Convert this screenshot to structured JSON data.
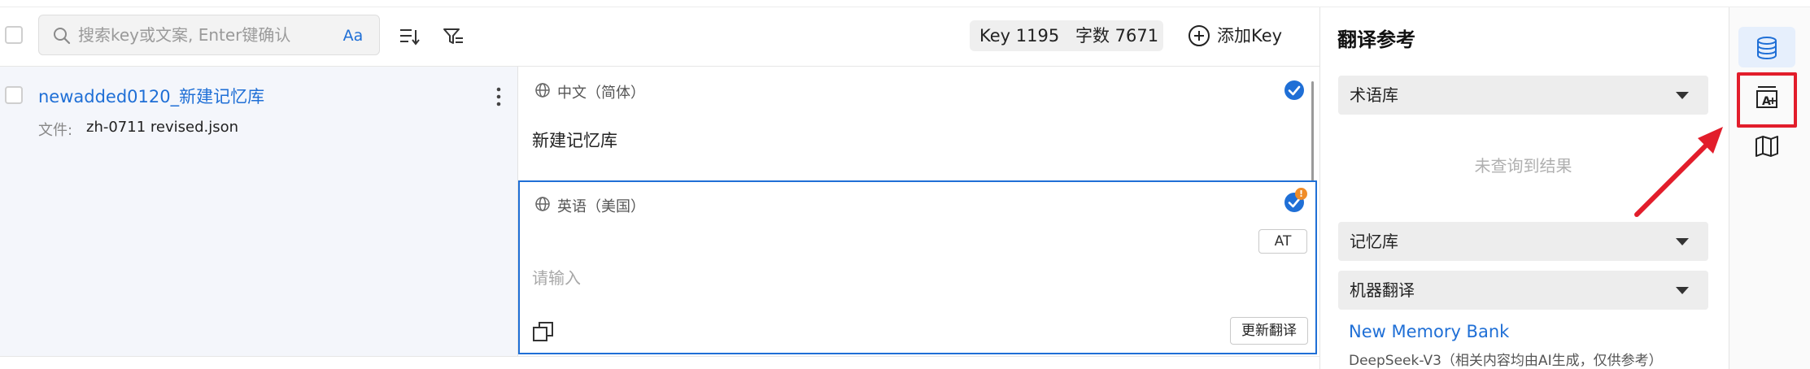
{
  "toolbar": {
    "search_placeholder": "搜索key或文案, Enter键确认",
    "case_toggle": "Aa",
    "stats_key": "Key 1195",
    "stats_chars": "字数 7671",
    "add_key_label": "添加Key"
  },
  "entry": {
    "key_name": "newadded0120_新建记忆库",
    "file_label": "文件:",
    "file_name": "zh-0711 revised.json",
    "source": {
      "language": "中文（简体）",
      "text": "新建记忆库"
    },
    "target": {
      "language": "英语（美国）",
      "at_label": "AT",
      "placeholder": "请输入",
      "update_label": "更新翻译",
      "warning": "!"
    }
  },
  "reference_panel": {
    "title": "翻译参考",
    "sections": [
      {
        "label": "术语库"
      },
      {
        "label": "记忆库"
      },
      {
        "label": "机器翻译"
      }
    ],
    "empty_text": "未查询到结果",
    "memory_name": "New Memory Bank",
    "memory_note": "DeepSeek-V3（相关内容均由AI生成，仅供参考）"
  },
  "rail": {
    "icons": [
      "database-icon",
      "translate-ai-icon",
      "map-icon"
    ],
    "highlight_color": "#e21d2b"
  },
  "colors": {
    "accent": "#1f6fd6",
    "warning": "#f08c28"
  }
}
